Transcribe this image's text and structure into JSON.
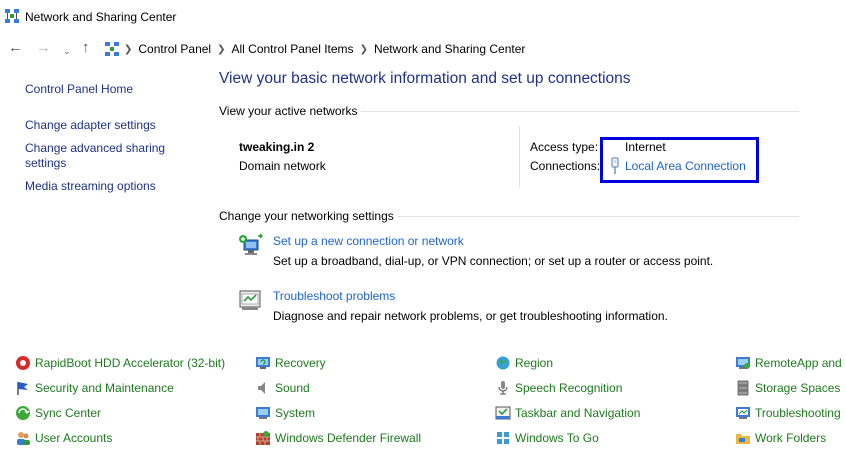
{
  "window": {
    "title": "Network and Sharing Center"
  },
  "addressbar": {
    "crumbs": [
      "Control Panel",
      "All Control Panel Items",
      "Network and Sharing Center"
    ]
  },
  "sidebar": {
    "items": [
      {
        "label": "Control Panel Home"
      },
      {
        "label": "Change adapter settings"
      },
      {
        "label": "Change advanced sharing settings"
      },
      {
        "label": "Media streaming options"
      }
    ]
  },
  "main": {
    "heading": "View your basic network information and set up connections",
    "active_networks_label": "View your active networks",
    "network": {
      "name": "tweaking.in 2",
      "type": "Domain network",
      "access_type_label": "Access type:",
      "access_type_value": "Internet",
      "connections_label": "Connections:",
      "connections_value": "Local Area Connection"
    },
    "change_settings_label": "Change your networking settings",
    "tasks": [
      {
        "link": "Set up a new connection or network",
        "desc": "Set up a broadband, dial-up, or VPN connection; or set up a router or access point.",
        "icon": "new-connection-icon"
      },
      {
        "link": "Troubleshoot problems",
        "desc": "Diagnose and repair network problems, or get troubleshooting information.",
        "icon": "troubleshoot-icon"
      }
    ]
  },
  "control_panel_items": [
    {
      "label": "RapidBoot HDD Accelerator (32-bit)",
      "icon": "rapidboot-icon"
    },
    {
      "label": "Security and Maintenance",
      "icon": "flag-icon"
    },
    {
      "label": "Sync Center",
      "icon": "sync-icon"
    },
    {
      "label": "User Accounts",
      "icon": "users-icon"
    },
    {
      "label": "Recovery",
      "icon": "recovery-icon"
    },
    {
      "label": "Sound",
      "icon": "speaker-icon"
    },
    {
      "label": "System",
      "icon": "system-icon"
    },
    {
      "label": "Windows Defender Firewall",
      "icon": "firewall-icon"
    },
    {
      "label": "Region",
      "icon": "globe-icon"
    },
    {
      "label": "Speech Recognition",
      "icon": "microphone-icon"
    },
    {
      "label": "Taskbar and Navigation",
      "icon": "taskbar-icon"
    },
    {
      "label": "Windows To Go",
      "icon": "windows-to-go-icon"
    },
    {
      "label": "RemoteApp and D",
      "icon": "remoteapp-icon"
    },
    {
      "label": "Storage Spaces",
      "icon": "storage-icon"
    },
    {
      "label": "Troubleshooting",
      "icon": "troubleshooting-icon"
    },
    {
      "label": "Work Folders",
      "icon": "folder-icon"
    }
  ],
  "colors": {
    "link_blue": "#1e3287",
    "link_light_blue": "#1e64c8",
    "cp_green": "#1e7a1e",
    "highlight_border": "#0000e0"
  }
}
